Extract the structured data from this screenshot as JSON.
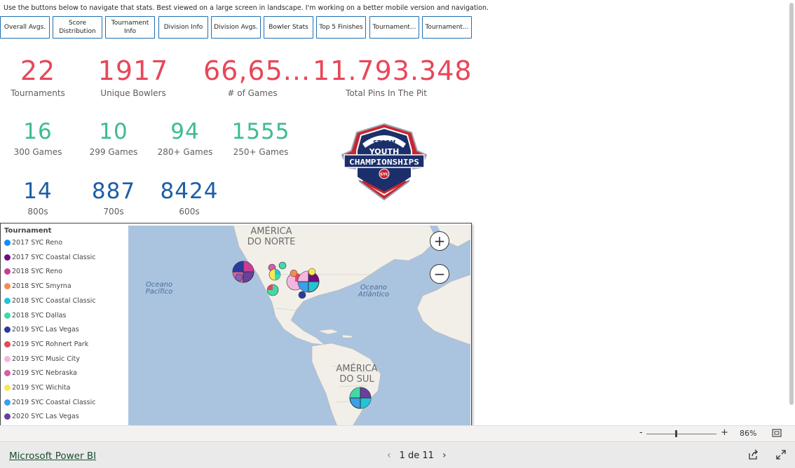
{
  "instructions": "Use the buttons below to navigate that stats. Best viewed on a large screen in landscape.  I'm working on a better mobile version and navigation.",
  "nav_buttons": [
    {
      "label": "Overall Avgs."
    },
    {
      "label": "Score Distribution"
    },
    {
      "label": "Tournament Info"
    },
    {
      "label": "Division Info"
    },
    {
      "label": "Division Avgs."
    },
    {
      "label": "Bowler Stats"
    },
    {
      "label": "Top 5 Finishes"
    },
    {
      "label": "Tournament..."
    },
    {
      "label": "Tournament..."
    }
  ],
  "kpis_row1": [
    {
      "value": "22",
      "label": "Tournaments"
    },
    {
      "value": "1917",
      "label": "Unique Bowlers"
    },
    {
      "value": "66,65...",
      "label": "# of Games"
    },
    {
      "value": "11.793.348",
      "label": "Total Pins In The Pit"
    }
  ],
  "kpis_row2": [
    {
      "value": "16",
      "label": "300 Games"
    },
    {
      "value": "10",
      "label": "299 Games"
    },
    {
      "value": "94",
      "label": "280+ Games"
    },
    {
      "value": "1555",
      "label": "250+ Games"
    }
  ],
  "kpis_row3": [
    {
      "value": "14",
      "label": "800s"
    },
    {
      "value": "887",
      "label": "700s"
    },
    {
      "value": "8424",
      "label": "600s"
    }
  ],
  "logo": {
    "brand": "STORM",
    "line1": "YOUTH",
    "line2": "CHAMPIONSHIPS",
    "badge": "SYC"
  },
  "map": {
    "legend_title": "Tournament",
    "legend": [
      {
        "label": "2017 SYC Reno",
        "color": "#118dff"
      },
      {
        "label": "2017 SYC Coastal Classic",
        "color": "#750985"
      },
      {
        "label": "2018 SYC Reno",
        "color": "#c83d95"
      },
      {
        "label": "2018 SYC Smyrna",
        "color": "#f28c54"
      },
      {
        "label": "2018 SYC Coastal Classic",
        "color": "#21c5d5"
      },
      {
        "label": "2018 SYC Dallas",
        "color": "#41d9a8"
      },
      {
        "label": "2019 SYC Las Vegas",
        "color": "#2a3b9e"
      },
      {
        "label": "2019 SYC Rohnert Park",
        "color": "#e8475a"
      },
      {
        "label": "2019 SYC Music City",
        "color": "#f6b5e1"
      },
      {
        "label": "2019 SYC Nebraska",
        "color": "#d65ea8"
      },
      {
        "label": "2019 SYC Wichita",
        "color": "#f5ea4f"
      },
      {
        "label": "2019 SYC Coastal Classic",
        "color": "#3a9ee8"
      },
      {
        "label": "2020 SYC Las Vegas",
        "color": "#6b3fa0"
      }
    ],
    "labels": {
      "north_america_1": "AMÉRICA",
      "north_america_2": "DO NORTE",
      "pacific_1": "Oceano",
      "pacific_2": "Pacífico",
      "atlantic_1": "Oceano",
      "atlantic_2": "Atlântico",
      "south_america_1": "AMÉRICA",
      "south_america_2": "DO SUL"
    },
    "zoom_in_symbol": "+",
    "zoom_out_symbol": "−"
  },
  "statusbar": {
    "minus": "-",
    "plus": "+",
    "zoom_level": "86%"
  },
  "footer": {
    "app_link": "Microsoft Power BI",
    "page_indicator": "1 de 11",
    "prev_symbol": "‹",
    "next_symbol": "›"
  }
}
